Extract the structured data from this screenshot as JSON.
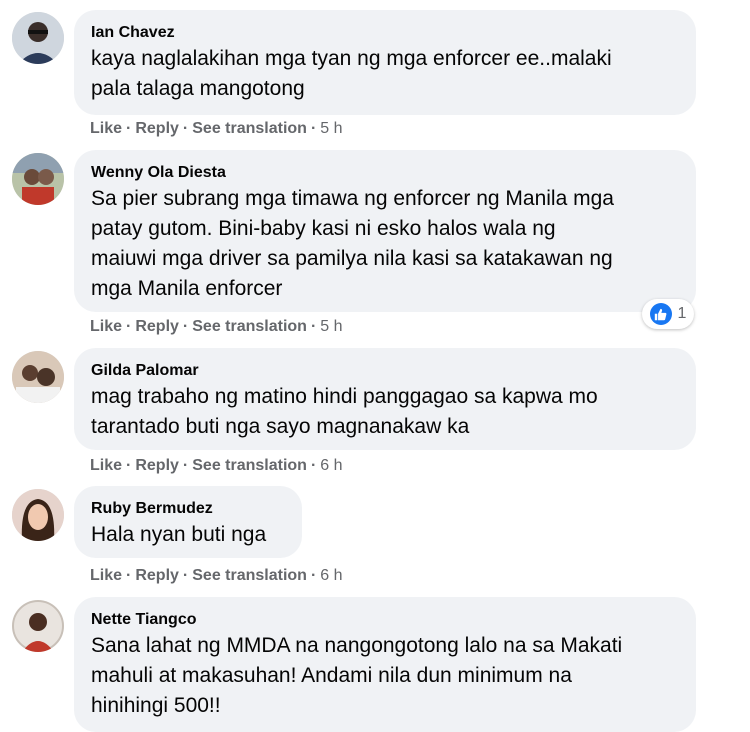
{
  "comments": [
    {
      "name": "Ian Chavez",
      "text": "kaya naglalakihan mga tyan ng mga enforcer ee..malaki\npala talaga mangotong",
      "like": "Like",
      "reply": "Reply",
      "translate": "See translation",
      "time": "5 h"
    },
    {
      "name": "Wenny Ola Diesta",
      "text": "Sa pier subrang mga timawa ng enforcer ng Manila mga\npatay gutom. Bini-baby kasi ni esko halos wala ng\nmaiuwi mga driver sa pamilya nila kasi sa katakawan ng\nmga Manila enforcer",
      "like": "Like",
      "reply": "Reply",
      "translate": "See translation",
      "time": "5 h",
      "reaction_count": "1"
    },
    {
      "name": "Gilda Palomar",
      "text": "mag trabaho ng matino hindi panggagao sa kapwa mo\ntarantado buti nga sayo magnanakaw ka",
      "like": "Like",
      "reply": "Reply",
      "translate": "See translation",
      "time": "6 h"
    },
    {
      "name": "Ruby Bermudez",
      "text": "Hala nyan buti nga",
      "like": "Like",
      "reply": "Reply",
      "translate": "See translation",
      "time": "6 h"
    },
    {
      "name": "Nette Tiangco",
      "text": "Sana lahat ng MMDA na nangongotong lalo na sa Makati\nmahuli at makasuhan! Andami nila dun minimum na\nhinihingi 500!!"
    }
  ],
  "colors": {
    "bubble": "#f0f2f5",
    "meta_text": "#65676b",
    "like_blue": "#1877f2"
  },
  "icons": {
    "reaction": "like-thumb-icon"
  }
}
